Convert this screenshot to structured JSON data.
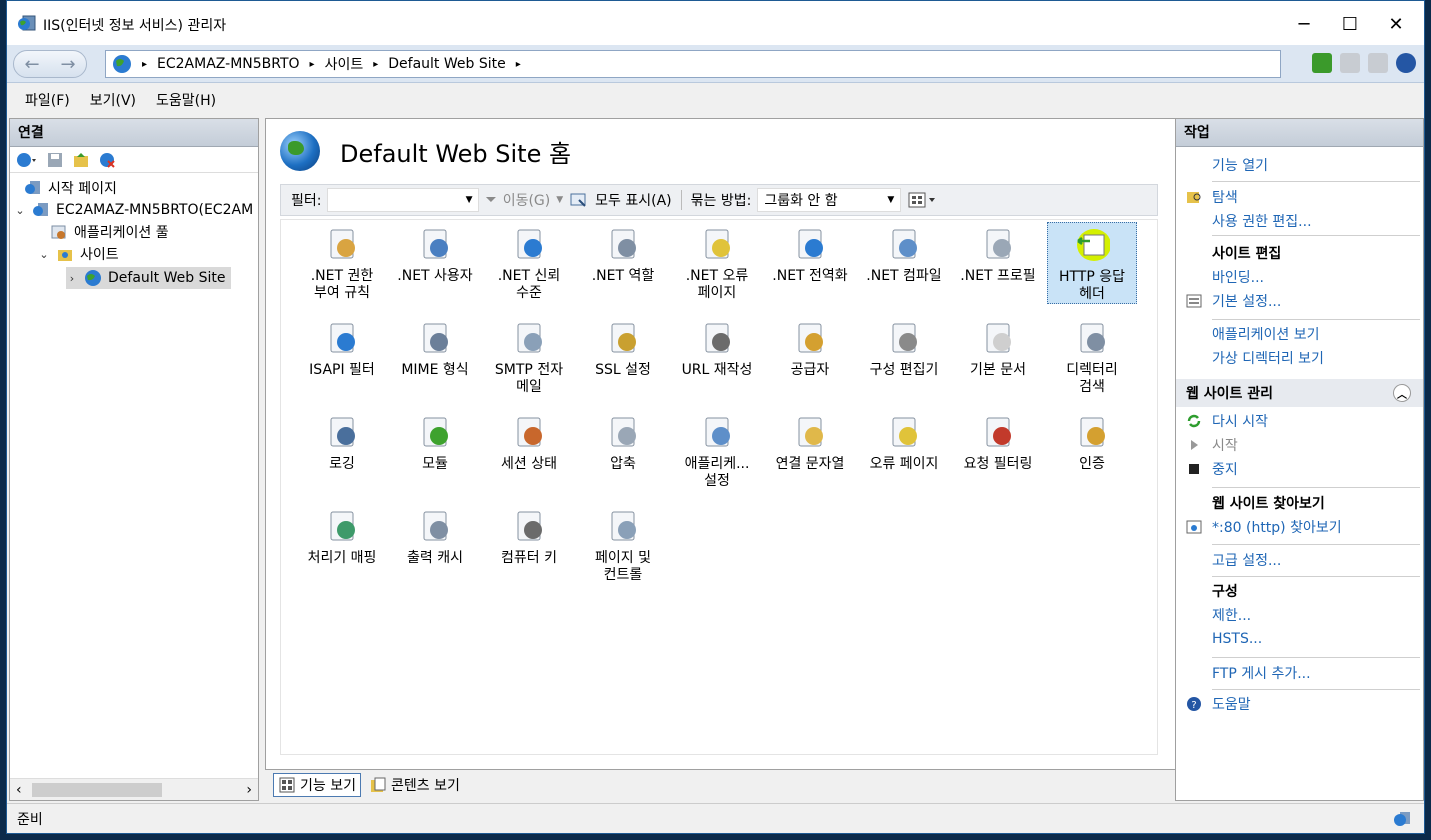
{
  "window": {
    "title": "IIS(인터넷 정보 서비스) 관리자",
    "minimize": "─",
    "maximize": "☐",
    "close": "✕"
  },
  "address": {
    "crumbs": [
      "EC2AMAZ-MN5BRTO",
      "사이트",
      "Default Web Site"
    ],
    "separator": "▸"
  },
  "menu": [
    "파일(F)",
    "보기(V)",
    "도움말(H)"
  ],
  "connections": {
    "title": "연결",
    "tree": {
      "start_page": "시작 페이지",
      "server": "EC2AMAZ-MN5BRTO(EC2AM",
      "app_pools": "애플리케이션 풀",
      "sites": "사이트",
      "default_site": "Default Web Site"
    }
  },
  "center": {
    "title": "Default Web Site 홈",
    "filter_label": "필터:",
    "go_label": "이동(G)",
    "show_all_label": "모두 표시(A)",
    "group_by_label": "묶는 방법:",
    "group_by_value": "그룹화 안 함",
    "features": [
      [
        ".NET 권한",
        "부여 규칙"
      ],
      [
        ".NET 사용자",
        ""
      ],
      [
        ".NET 신뢰",
        "수준"
      ],
      [
        ".NET 역할",
        ""
      ],
      [
        ".NET 오류",
        "페이지"
      ],
      [
        ".NET 전역화",
        ""
      ],
      [
        ".NET 컴파일",
        ""
      ],
      [
        ".NET 프로필",
        ""
      ],
      [
        "HTTP 응답",
        "헤더"
      ],
      [
        "ISAPI 필터",
        ""
      ],
      [
        "MIME 형식",
        ""
      ],
      [
        "SMTP 전자",
        "메일"
      ],
      [
        "SSL 설정",
        ""
      ],
      [
        "URL 재작성",
        ""
      ],
      [
        "공급자",
        ""
      ],
      [
        "구성 편집기",
        ""
      ],
      [
        "기본 문서",
        ""
      ],
      [
        "디렉터리",
        "검색"
      ],
      [
        "로깅",
        ""
      ],
      [
        "모듈",
        ""
      ],
      [
        "세션 상태",
        ""
      ],
      [
        "압축",
        ""
      ],
      [
        "애플리케...",
        "설정"
      ],
      [
        "연결 문자열",
        ""
      ],
      [
        "오류 페이지",
        ""
      ],
      [
        "요청 필터링",
        ""
      ],
      [
        "인증",
        ""
      ],
      [
        "처리기 매핑",
        ""
      ],
      [
        "출력 캐시",
        ""
      ],
      [
        "컴퓨터 키",
        ""
      ],
      [
        "페이지 및",
        "컨트롤"
      ]
    ],
    "selected_feature": "HTTP 응답 헤더",
    "tabs": {
      "features_view": "기능 보기",
      "content_view": "콘텐츠 보기"
    }
  },
  "actions": {
    "title": "작업",
    "open_feature": "기능 열기",
    "explore": "탐색",
    "edit_permissions": "사용 권한 편집...",
    "edit_site_header": "사이트 편집",
    "bindings": "바인딩...",
    "basic_settings": "기본 설정...",
    "view_applications": "애플리케이션 보기",
    "view_virtual_dirs": "가상 디렉터리 보기",
    "manage_site_header": "웹 사이트 관리",
    "restart": "다시 시작",
    "start": "시작",
    "stop": "중지",
    "browse_header": "웹 사이트 찾아보기",
    "browse_link": "*:80 (http) 찾아보기",
    "advanced_settings": "고급 설정...",
    "config_header": "구성",
    "limits": "제한...",
    "hsts": "HSTS...",
    "add_ftp": "FTP 게시 추가...",
    "help": "도움말"
  },
  "status": {
    "text": "준비"
  },
  "colors": {
    "accent": "#1f66b5",
    "selection": "#c9e3f7",
    "highlight_marker": "#d4f000"
  }
}
